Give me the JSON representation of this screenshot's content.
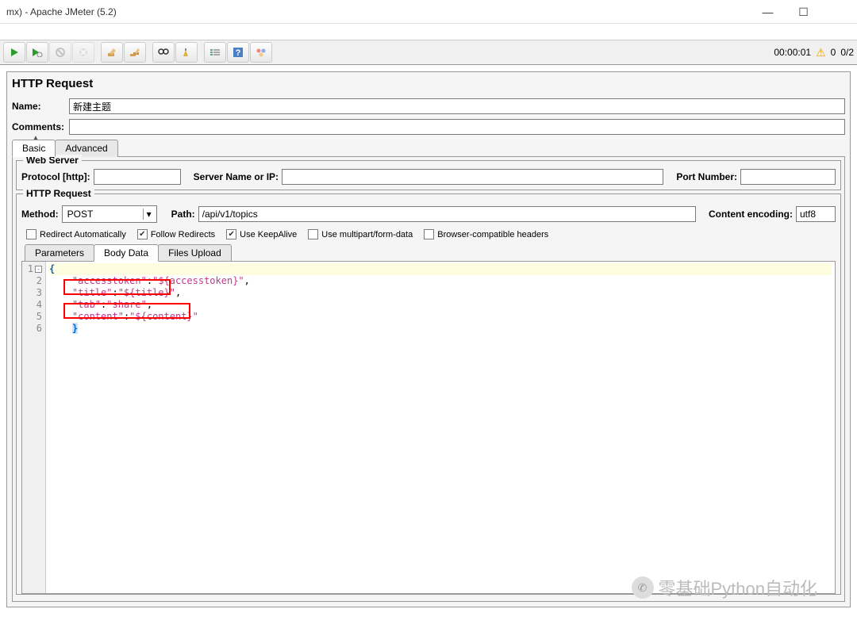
{
  "window": {
    "title": "mx) - Apache JMeter (5.2)"
  },
  "toolbar_status": {
    "timer": "00:00:01",
    "warn_count": "0",
    "ratio": "0/2"
  },
  "panel": {
    "title": "HTTP Request"
  },
  "fields": {
    "name_label": "Name:",
    "name_value": "新建主题",
    "comments_label": "Comments:",
    "comments_value": ""
  },
  "tabs": {
    "basic": "Basic",
    "advanced": "Advanced"
  },
  "webserver": {
    "legend": "Web Server",
    "protocol_label": "Protocol [http]:",
    "protocol_value": "",
    "servername_label": "Server Name or IP:",
    "servername_value": "",
    "port_label": "Port Number:",
    "port_value": ""
  },
  "httpreq": {
    "legend": "HTTP Request",
    "method_label": "Method:",
    "method_value": "POST",
    "path_label": "Path:",
    "path_value": "/api/v1/topics",
    "encoding_label": "Content encoding:",
    "encoding_value": "utf8"
  },
  "checkboxes": {
    "redirect_auto": "Redirect Automatically",
    "follow_redirects": "Follow Redirects",
    "keepalive": "Use KeepAlive",
    "multipart": "Use multipart/form-data",
    "browser_compat": "Browser-compatible headers"
  },
  "subtabs": {
    "parameters": "Parameters",
    "bodydata": "Body Data",
    "filesupload": "Files Upload"
  },
  "editor": {
    "lines": {
      "l1": "{",
      "l2_k": "\"accesstoken\"",
      "l2_v": "\"${accesstoken}\"",
      "l3_k": "\"title\"",
      "l3_v": "\"${title}\"",
      "l4_k": "\"tab\"",
      "l4_v": "\"share\"",
      "l5_k": "\"content\"",
      "l5_v": "\"${content}\"",
      "l6": "}"
    }
  },
  "watermark": "零基础Python自动化"
}
